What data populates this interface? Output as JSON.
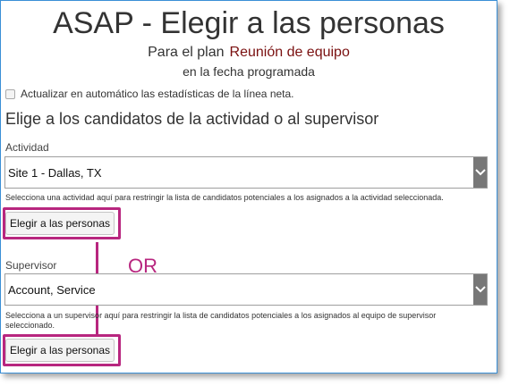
{
  "header": {
    "title": "ASAP - Elegir a las personas",
    "plan_prefix": "Para el plan",
    "plan_name": "Reunión de equipo",
    "date_line": "en la fecha programada"
  },
  "options": {
    "auto_update_label": "Actualizar en automático las estadísticas de la línea neta."
  },
  "section": {
    "heading": "Elige a los candidatos de la actividad o al supervisor"
  },
  "activity": {
    "label": "Actividad",
    "selected": "Site 1 - Dallas, TX",
    "help": "Selecciona una actividad aquí para restringir la lista de candidatos potenciales a los asignados a la actividad seleccionada.",
    "button_label": "Elegir a las personas"
  },
  "supervisor": {
    "label": "Supervisor",
    "selected": "Account, Service",
    "help": "Selecciona a un supervisor aquí para restringir la lista de candidatos potenciales a los asignados al equipo de supervisor seleccionado.",
    "button_label": "Elegir a las personas"
  },
  "annotation": {
    "or_text": "OR"
  },
  "colors": {
    "highlight": "#b8267f",
    "plan_name": "#7a1010",
    "frame_border": "#3a8fd6"
  },
  "icons": {
    "dropdown": "chevron-down-icon",
    "checkbox": "checkbox-unchecked-icon"
  }
}
